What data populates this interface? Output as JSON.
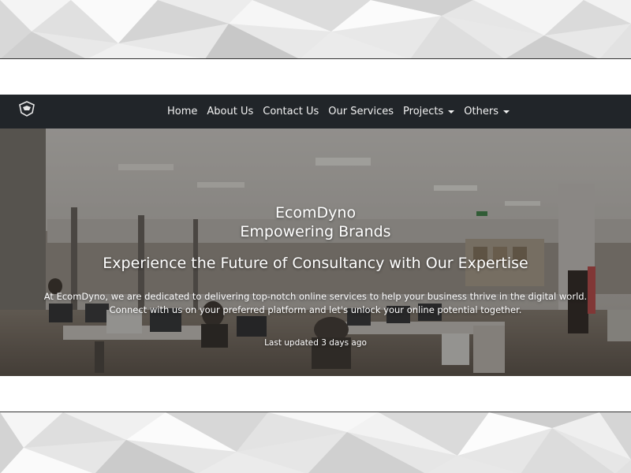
{
  "nav": {
    "brand_icon": "logo-icon",
    "items": [
      {
        "label": "Home"
      },
      {
        "label": "About Us"
      },
      {
        "label": "Contact Us"
      },
      {
        "label": "Our Services"
      },
      {
        "label": "Projects",
        "dropdown": true
      },
      {
        "label": "Others",
        "dropdown": true
      }
    ]
  },
  "hero": {
    "title": "EcomDyno",
    "subtitle": "Empowering Brands",
    "tagline": "Experience the Future of Consultancy with Our Expertise",
    "description_line1": "At EcomDyno, we are dedicated to delivering top-notch online services to help your business thrive in the digital world.",
    "description_line2": "Connect with us on your preferred platform and let's unlock your online potential together.",
    "updated": "Last updated 3 days ago"
  },
  "colors": {
    "navbar_bg": "#212529",
    "nav_text": "#f2f2f2",
    "hero_text": "#ffffff"
  }
}
